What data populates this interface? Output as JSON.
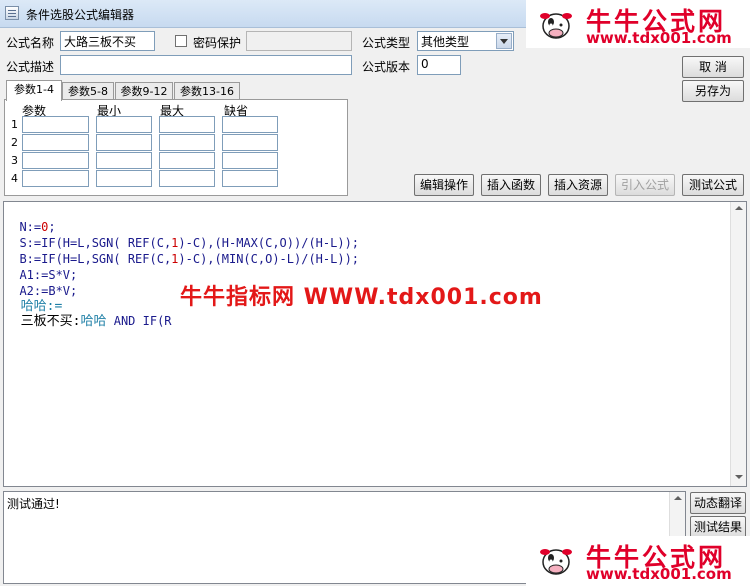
{
  "window": {
    "title": "条件选股公式编辑器"
  },
  "form": {
    "name_label": "公式名称",
    "name_value": "大路三板不买",
    "password_label": "密码保护",
    "password_value": "",
    "type_label": "公式类型",
    "type_value": "其他类型",
    "desc_label": "公式描述",
    "desc_value": "",
    "version_label": "公式版本",
    "version_value": "0"
  },
  "right_buttons": {
    "cancel": "取  消",
    "save_as": "另存为"
  },
  "tabs": [
    "参数1-4",
    "参数5-8",
    "参数9-12",
    "参数13-16"
  ],
  "params": {
    "headers": [
      "参数",
      "最小",
      "最大",
      "缺省"
    ],
    "rows": [
      "1",
      "2",
      "3",
      "4"
    ]
  },
  "toolbar": {
    "edit": "编辑操作",
    "insert_func": "插入函数",
    "insert_res": "插入资源",
    "import_formula": "引入公式",
    "test_formula": "测试公式"
  },
  "code_lines": [
    [
      {
        "t": "N:=",
        "c": "kw"
      },
      {
        "t": "0",
        "c": "num"
      },
      {
        "t": ";",
        "c": "kw"
      }
    ],
    [
      {
        "t": "S:=IF(H=L,SGN( REF(C,",
        "c": "kw"
      },
      {
        "t": "1",
        "c": "num"
      },
      {
        "t": ")-C),(H-MAX(C,O))/(H-L));",
        "c": "kw"
      }
    ],
    [
      {
        "t": "B:=IF(H=L,SGN( REF(C,",
        "c": "kw"
      },
      {
        "t": "1",
        "c": "num"
      },
      {
        "t": ")-C),(MIN(C,O)-L)/(H-L));",
        "c": "kw"
      }
    ],
    [
      {
        "t": "A1:=S*V;",
        "c": "kw"
      }
    ],
    [
      {
        "t": "A2:=B*V;",
        "c": "kw"
      }
    ],
    [
      {
        "t": "哈哈:=",
        "c": "var"
      }
    ],
    [
      {
        "t": "三板不买:",
        "c": "cjk"
      },
      {
        "t": "哈哈",
        "c": "var"
      },
      {
        "t": " AND IF(R",
        "c": "kw"
      }
    ]
  ],
  "watermark": "牛牛指标网 WWW.tdx001.com",
  "output": {
    "text": "测试通过!"
  },
  "bottom_buttons": {
    "translate": "动态翻译",
    "result": "测试结果"
  },
  "logo": {
    "name": "牛牛公式网",
    "url": "www.tdx001.com"
  },
  "colors": {
    "logo_red": "#e0002a",
    "keyword": "#1a1a8c",
    "number": "#cc0000",
    "variable": "#1e7fa6"
  }
}
